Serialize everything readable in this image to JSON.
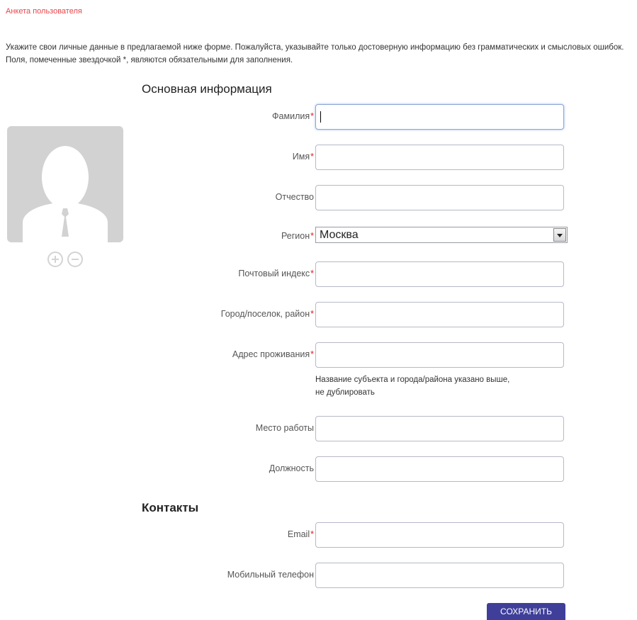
{
  "page": {
    "heading": "Анкета пользователя",
    "intro": "Укажите свои личные данные в предлагаемой ниже форме. Пожалуйста, указывайте только достоверную информацию без грамматических и смысловых ошибок. Поля, помеченные звездочкой *, являются обязательными для заполнения."
  },
  "sections": {
    "main_title": "Основная информация",
    "contacts_title": "Контакты"
  },
  "required_mark": "*",
  "fields": {
    "last_name": {
      "label": "Фамилия",
      "required": true,
      "value": ""
    },
    "first_name": {
      "label": "Имя",
      "required": true,
      "value": ""
    },
    "patronymic": {
      "label": "Отчество",
      "required": false,
      "value": ""
    },
    "region": {
      "label": "Регион",
      "required": true,
      "value": "Москва"
    },
    "postal_code": {
      "label": "Почтовый индекс",
      "required": true,
      "value": ""
    },
    "city": {
      "label": "Город/поселок, район",
      "required": true,
      "value": ""
    },
    "address": {
      "label": "Адрес проживания",
      "required": true,
      "value": "",
      "hint_line1": "Название субъекта и города/района указано выше,",
      "hint_line2": "не дублировать"
    },
    "workplace": {
      "label": "Место работы",
      "required": false,
      "value": ""
    },
    "position": {
      "label": "Должность",
      "required": false,
      "value": ""
    },
    "email": {
      "label": "Email",
      "required": true,
      "value": ""
    },
    "mobile": {
      "label": "Мобильный телефон",
      "required": false,
      "value": ""
    }
  },
  "avatar": {
    "add_icon": "plus-circle-icon",
    "remove_icon": "minus-circle-icon"
  },
  "actions": {
    "save_label": "Сохранить"
  },
  "colors": {
    "heading": "#e8464c",
    "required": "#e02020",
    "button_bg": "#3f3f9a",
    "avatar_bg": "#d2d2d2"
  }
}
